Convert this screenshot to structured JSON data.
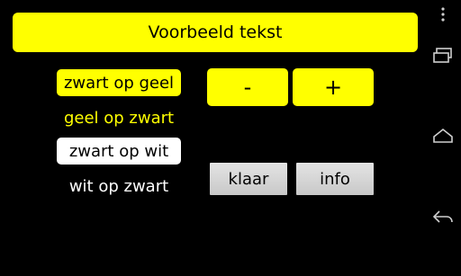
{
  "preview": {
    "text": "Voorbeeld tekst"
  },
  "options": {
    "zwart_op_geel": "zwart op geel",
    "geel_op_zwart": "geel op zwart",
    "zwart_op_wit": "zwart op wit",
    "wit_op_zwart": "wit op zwart"
  },
  "size_controls": {
    "minus": "-",
    "plus": "+"
  },
  "actions": {
    "klaar": "klaar",
    "info": "info"
  },
  "colors": {
    "accent": "#ffff00",
    "background": "#000000",
    "button_gray": "#d6d6d6",
    "white": "#ffffff"
  },
  "navbar": {
    "icons": [
      "menu-icon",
      "recent-apps-icon",
      "home-icon",
      "back-icon"
    ]
  }
}
